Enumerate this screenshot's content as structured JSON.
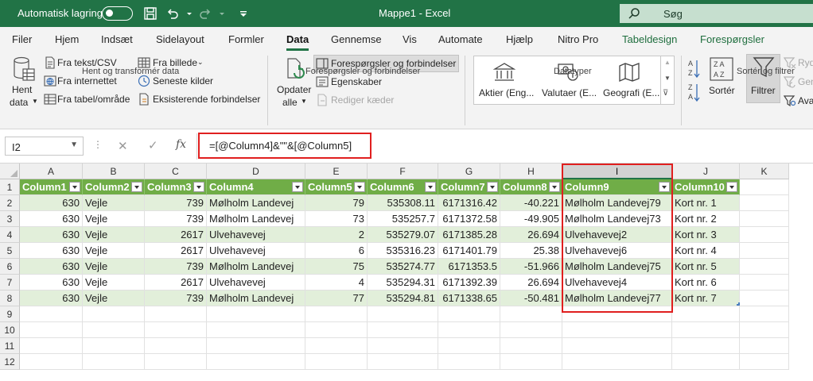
{
  "titlebar": {
    "autosave_label": "Automatisk lagring",
    "title": "Mappe1  -  Excel",
    "search_label": "Søg"
  },
  "menu": [
    "Filer",
    "Hjem",
    "Indsæt",
    "Sidelayout",
    "Formler",
    "Data",
    "Gennemse",
    "Vis",
    "Automate",
    "Hjælp",
    "Nitro Pro",
    "Tabeldesign",
    "Forespørgsler"
  ],
  "menu_active": "Data",
  "ribbon": {
    "get_data": [
      "Hent",
      "data"
    ],
    "from_text_csv": "Fra tekst/CSV",
    "from_web": "Fra internettet",
    "from_table": "Fra tabel/område",
    "from_picture": "Fra billede",
    "recent_sources": "Seneste kilder",
    "existing_connections": "Eksisterende forbindelser",
    "group_get": "Hent og transformér data",
    "refresh_all": [
      "Opdater",
      "alle"
    ],
    "queries_connections": "Forespørgsler og forbindelser",
    "properties": "Egenskaber",
    "edit_links": "Rediger kæder",
    "group_queries": "Forespørgsler og forbindelser",
    "stocks": "Aktier (Eng...",
    "currencies": "Valutaer (E...",
    "geography": "Geografi (E...",
    "group_datatypes": "Datatyper",
    "sort": "Sortér",
    "filter": "Filtrer",
    "clear": "Ryd",
    "reapply": "Gen",
    "advanced": "Ava",
    "group_sort": "Sortér og filtrer"
  },
  "formula_bar": {
    "name_box": "I2",
    "formula": "=[@Column4]&\"\"&[@Column5]"
  },
  "columns": [
    "A",
    "B",
    "C",
    "D",
    "E",
    "F",
    "G",
    "H",
    "I",
    "J",
    "K"
  ],
  "selected_column": "I",
  "rows": [
    "1",
    "2",
    "3",
    "4",
    "5",
    "6",
    "7",
    "8",
    "9",
    "10",
    "11",
    "12"
  ],
  "table": {
    "headers": [
      "Column1",
      "Column2",
      "Column3",
      "Column4",
      "Column5",
      "Column6",
      "Column7",
      "Column8",
      "Column9",
      "Column10"
    ],
    "rows": [
      [
        "630",
        "Vejle",
        "739",
        "Mølholm Landevej",
        "79",
        "535308.11",
        "6171316.42",
        "-40.221",
        "Mølholm Landevej79",
        "Kort nr. 1"
      ],
      [
        "630",
        "Vejle",
        "739",
        "Mølholm Landevej",
        "73",
        "535257.7",
        "6171372.58",
        "-49.905",
        "Mølholm Landevej73",
        "Kort nr. 2"
      ],
      [
        "630",
        "Vejle",
        "2617",
        "Ulvehavevej",
        "2",
        "535279.07",
        "6171385.28",
        "26.694",
        "Ulvehavevej2",
        "Kort nr. 3"
      ],
      [
        "630",
        "Vejle",
        "2617",
        "Ulvehavevej",
        "6",
        "535316.23",
        "6171401.79",
        "25.38",
        "Ulvehavevej6",
        "Kort nr. 4"
      ],
      [
        "630",
        "Vejle",
        "739",
        "Mølholm Landevej",
        "75",
        "535274.77",
        "6171353.5",
        "-51.966",
        "Mølholm Landevej75",
        "Kort nr. 5"
      ],
      [
        "630",
        "Vejle",
        "2617",
        "Ulvehavevej",
        "4",
        "535294.31",
        "6171392.39",
        "26.694",
        "Ulvehavevej4",
        "Kort nr. 6"
      ],
      [
        "630",
        "Vejle",
        "739",
        "Mølholm Landevej",
        "77",
        "535294.81",
        "6171338.65",
        "-50.481",
        "Mølholm Landevej77",
        "Kort nr. 7"
      ]
    ]
  },
  "colors": {
    "excel_green": "#217346",
    "table_header": "#70ad47",
    "table_band": "#e2efda",
    "highlight": "#e01f1f"
  }
}
